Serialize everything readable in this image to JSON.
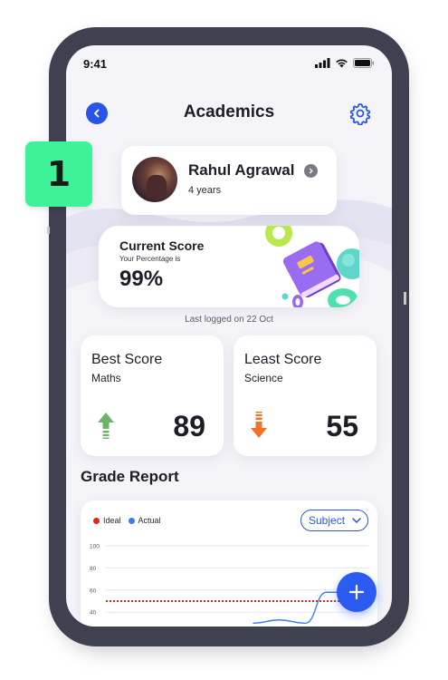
{
  "status_bar": {
    "time": "9:41"
  },
  "header": {
    "title": "Academics"
  },
  "profile": {
    "name": "Rahul Agrawal",
    "age": "4 years"
  },
  "current_score": {
    "title": "Current Score",
    "subtitle": "Your Percentage is",
    "value": "99%"
  },
  "last_logged": "Last logged on 22 Oct",
  "best_score": {
    "title": "Best Score",
    "subject": "Maths",
    "value": "89",
    "trend": "up",
    "color": "#6bb36b"
  },
  "least_score": {
    "title": "Least Score",
    "subject": "Science",
    "value": "55",
    "trend": "down",
    "color": "#f2722a"
  },
  "grade_report": {
    "title": "Grade Report",
    "filter_label": "Subject"
  },
  "step_badge": {
    "number": "1",
    "color": "#3ef29a"
  },
  "chart_data": {
    "type": "line",
    "legend_placement": "top-left",
    "grid": true,
    "ylim": [
      30,
      105
    ],
    "yticks": [
      "100",
      "80",
      "60",
      "40"
    ],
    "series": [
      {
        "name": "Ideal",
        "color": "#e0271e",
        "style": "dotted",
        "points": [
          [
            0,
            50
          ],
          [
            1,
            50
          ]
        ]
      },
      {
        "name": "Actual",
        "color": "#3d7af0",
        "style": "solid",
        "points": [
          [
            0.56,
            30
          ],
          [
            0.66,
            33
          ],
          [
            0.76,
            30
          ],
          [
            0.84,
            58
          ],
          [
            1,
            58
          ]
        ]
      }
    ]
  },
  "colors": {
    "accent": "#2854e8",
    "fab": "#2b5bf0",
    "background": "#f4f4f9"
  },
  "icons": [
    "back-icon",
    "gear-icon",
    "chevron-right-icon",
    "arrow-up-icon",
    "arrow-down-icon",
    "chevron-down-icon",
    "plus-icon",
    "signal-icon",
    "wifi-icon",
    "battery-icon"
  ]
}
